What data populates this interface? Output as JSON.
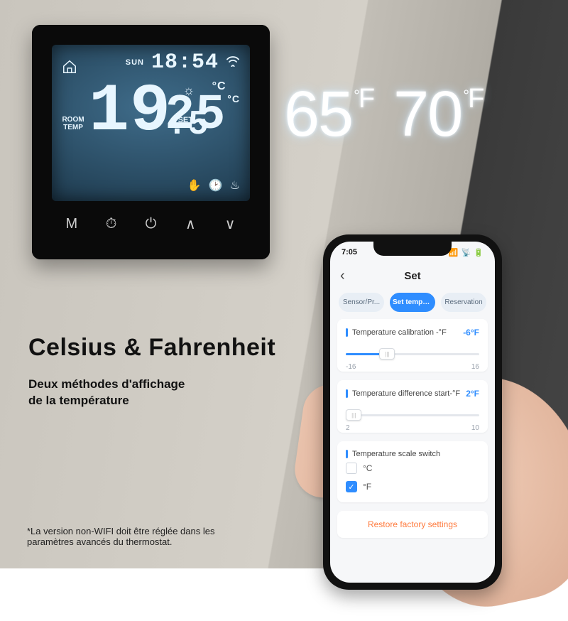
{
  "thermostat": {
    "day": "SUN",
    "clock": "18:54",
    "room_label": "ROOM\nTEMP",
    "room_temp_int": "19",
    "room_temp_dec": ".5",
    "room_unit": "°C",
    "set_label": "SET",
    "set_temp": "25",
    "set_unit": "°C",
    "buttons": {
      "mode": "M",
      "schedule": "⏱",
      "power": "⏻",
      "up": "∧",
      "down": "∨"
    }
  },
  "big": {
    "t1": "65",
    "t2": "70",
    "unit_deg": "°",
    "unit_f": "F"
  },
  "copy": {
    "headline": "Celsius & Fahrenheit",
    "sub1": "Deux méthodes d'affichage",
    "sub2": "de la température",
    "disclaimer": "*La version non-WIFI doit être réglée dans les\nparamètres avancés du thermostat."
  },
  "phone": {
    "status_time": "7:05",
    "nav_title": "Set",
    "pills": [
      "Sensor/Pr...",
      "Set tempe...",
      "Reservation"
    ],
    "card1": {
      "label": "Temperature calibration -°F",
      "value": "-6°F",
      "min": "-16",
      "max": "16",
      "fill_pct": 31,
      "thumb_pct": 31
    },
    "card2": {
      "label": "Temperature difference start-°F",
      "value": "2°F",
      "min": "2",
      "max": "10",
      "fill_pct": 6,
      "thumb_pct": 6
    },
    "card3": {
      "label": "Temperature scale switch",
      "opt_c": "°C",
      "opt_f": "°F",
      "selected": "f"
    },
    "restore": "Restore factory settings"
  }
}
